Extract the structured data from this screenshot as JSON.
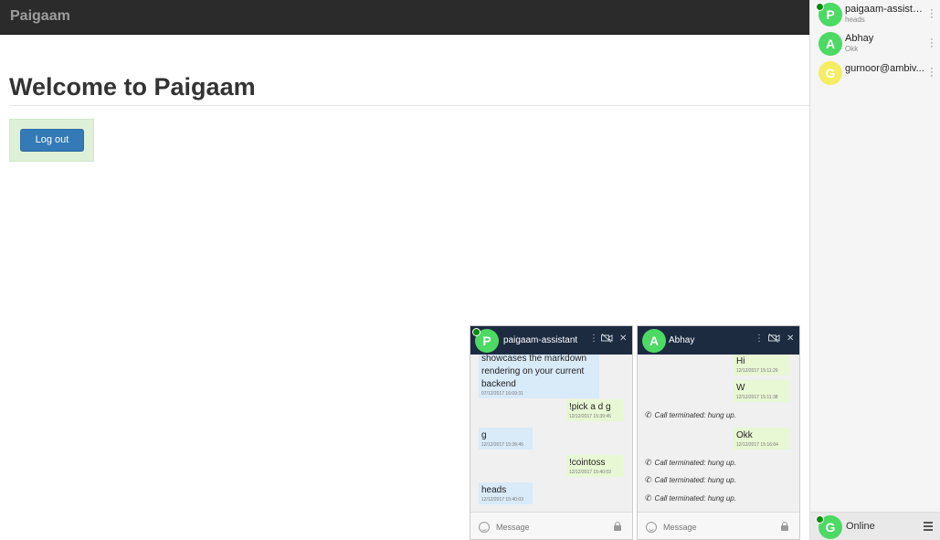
{
  "app": {
    "brand": "Paigaam",
    "welcome": "Welcome to Paigaam",
    "logout_label": "Log out"
  },
  "colors": {
    "navbar": "#2b2b2b",
    "button": "#337ab7",
    "avatar_green": "#4cd964",
    "avatar_yellow": "#f5ed62",
    "chat_header": "#1d2b40"
  },
  "roster": {
    "contacts": [
      {
        "initial": "P",
        "name": "paigaam-assistant",
        "status": "heads",
        "color": "green",
        "online": true
      },
      {
        "initial": "A",
        "name": "Abhay",
        "status": "Okk",
        "color": "green",
        "online": false
      },
      {
        "initial": "G",
        "name": "gurnoor@ambiv...",
        "status": "",
        "color": "yellow",
        "online": false
      }
    ],
    "me": {
      "initial": "G",
      "status": "Online"
    }
  },
  "chat1": {
    "initial": "P",
    "title": "paigaam-assistant",
    "placeholder": "Message",
    "messages": [
      {
        "dir": "in",
        "text1": "showcases the markdown",
        "text2": "rendering on your current",
        "text3": "backend",
        "time": "07/12/2017 16:09:31"
      },
      {
        "dir": "out",
        "text": "!pick a d g",
        "time": "12/12/2017 15:39:45"
      },
      {
        "dir": "in",
        "text": "g",
        "time": "12/12/2017 15:39:45"
      },
      {
        "dir": "out",
        "text": "!cointoss",
        "time": "12/12/2017 15:40:03"
      },
      {
        "dir": "in",
        "text": "heads",
        "time": "12/12/2017 15:40:03"
      }
    ]
  },
  "chat2": {
    "initial": "A",
    "title": "Abhay",
    "placeholder": "Message",
    "messages": [
      {
        "dir": "out",
        "text": "Hi",
        "time": "12/12/2017 15:11:29"
      },
      {
        "dir": "out",
        "text": "W",
        "time": "12/12/2017 15:11:38"
      },
      {
        "dir": "sys",
        "text": "Call terminated: hung up."
      },
      {
        "dir": "out",
        "text": "Okk",
        "time": "12/12/2017 15:16:04"
      },
      {
        "dir": "sys",
        "text": "Call terminated: hung up."
      },
      {
        "dir": "sys",
        "text": "Call terminated: hung up."
      },
      {
        "dir": "sys",
        "text": "Call terminated: hung up."
      }
    ]
  }
}
